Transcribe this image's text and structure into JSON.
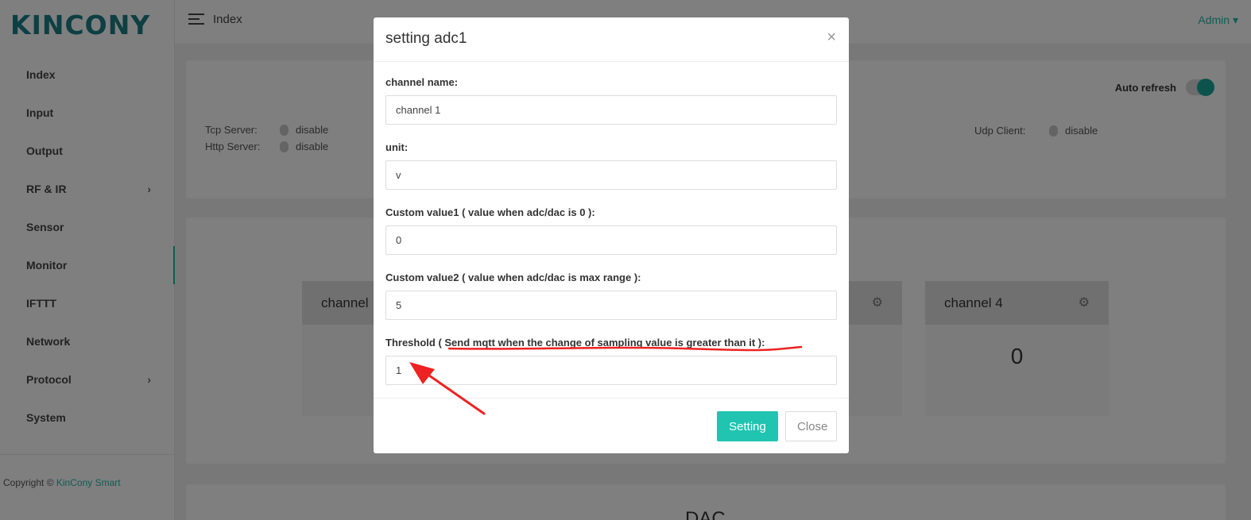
{
  "logo": "KINCONY",
  "sidebar": {
    "items": [
      {
        "label": "Index"
      },
      {
        "label": "Input"
      },
      {
        "label": "Output"
      },
      {
        "label": "RF & IR"
      },
      {
        "label": "Sensor"
      },
      {
        "label": "Monitor"
      },
      {
        "label": "IFTTT"
      },
      {
        "label": "Network"
      },
      {
        "label": "Protocol"
      },
      {
        "label": "System"
      }
    ],
    "copyright_prefix": "Copyright ©",
    "copyright_brand": "KinCony Smart"
  },
  "header": {
    "breadcrumb": "Index",
    "user": "Admin ▾"
  },
  "status": {
    "auto_refresh_label": "Auto refresh",
    "auto_refresh_on": true,
    "tcp_server_label": "Tcp Server:",
    "tcp_server_value": "disable",
    "http_server_label": "Http Server:",
    "http_server_value": "disable",
    "udp_client_label": "Udp Client:",
    "udp_client_value": "disable"
  },
  "channels": {
    "ch1_title": "channel",
    "ch4_title": "channel 4",
    "ch4_value": "0"
  },
  "dac_title": "DAC",
  "modal": {
    "title": "setting adc1",
    "close_glyph": "×",
    "fields": {
      "name_label": "channel name:",
      "name_value": "channel 1",
      "unit_label": "unit:",
      "unit_value": "v",
      "cv1_label": "Custom value1 ( value when adc/dac is 0 ):",
      "cv1_value": "0",
      "cv2_label": "Custom value2 ( value when adc/dac is max range ):",
      "cv2_value": "5",
      "threshold_label": "Threshold ( Send mqtt when the change of sampling value is greater than it ):",
      "threshold_value": "1"
    },
    "setting_button": "Setting",
    "close_button": "Close"
  },
  "colors": {
    "accent": "#20b9a8",
    "annotation": "#ee2222"
  }
}
